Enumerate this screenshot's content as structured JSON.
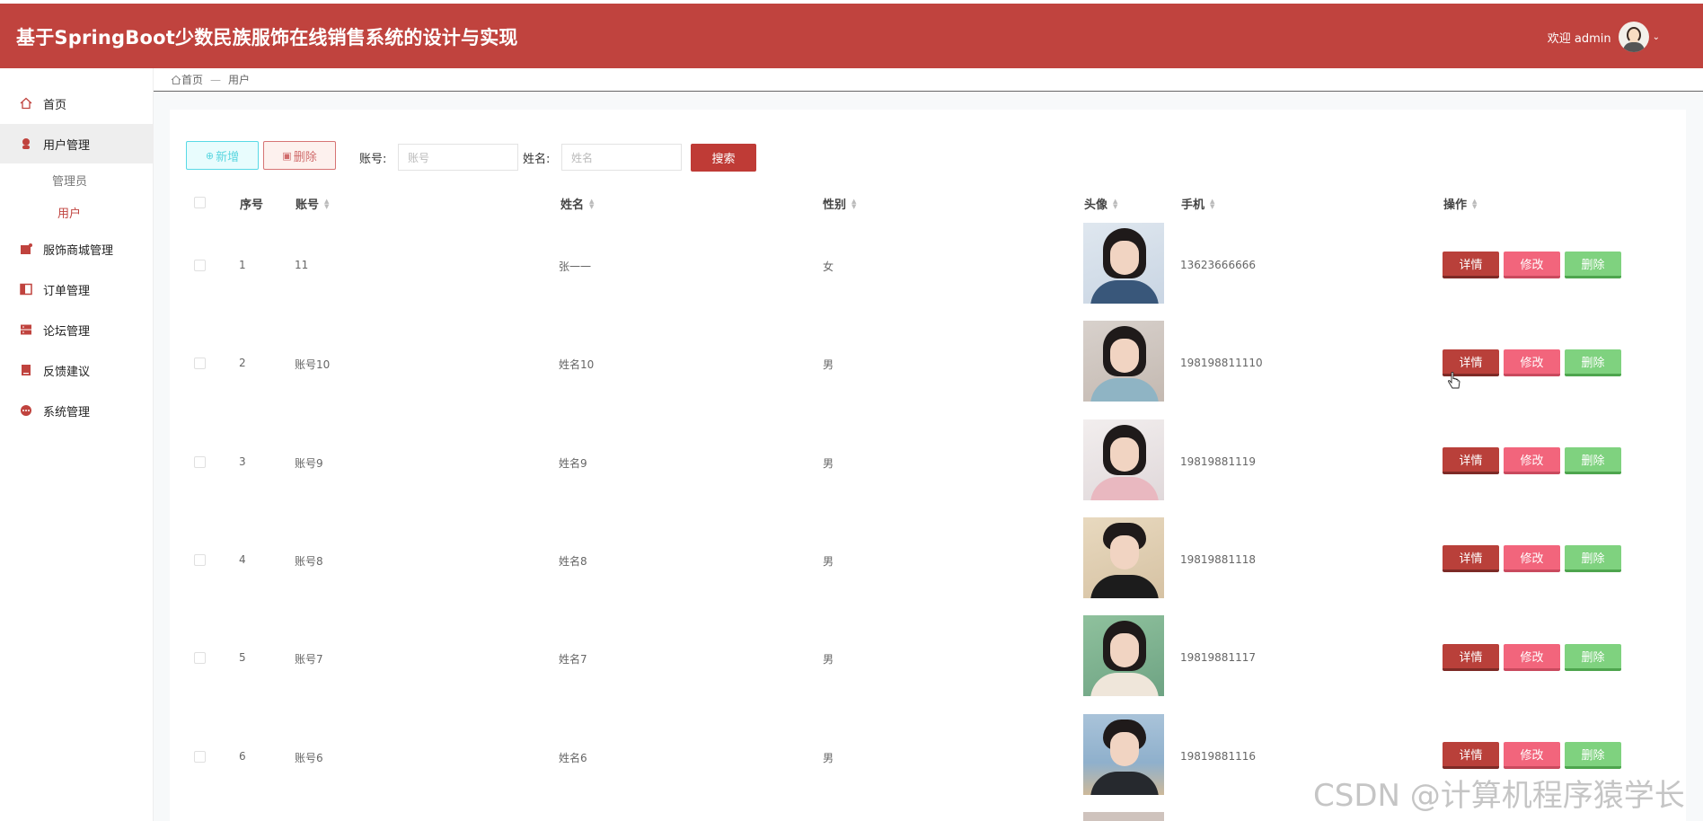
{
  "header": {
    "title": "基于SpringBoot少数民族服饰在线销售系统的设计与实现",
    "welcome": "欢迎 admin",
    "brand_color": "#c0433e"
  },
  "sidebar": {
    "items": [
      {
        "label": "首页",
        "icon": "home-icon"
      },
      {
        "label": "用户管理",
        "icon": "user-icon"
      },
      {
        "label": "服饰商城管理",
        "icon": "shop-icon"
      },
      {
        "label": "订单管理",
        "icon": "order-icon"
      },
      {
        "label": "论坛管理",
        "icon": "forum-icon"
      },
      {
        "label": "反馈建议",
        "icon": "feedback-icon"
      },
      {
        "label": "系统管理",
        "icon": "settings-icon"
      }
    ],
    "sub_items": [
      {
        "label": "管理员"
      },
      {
        "label": "用户"
      }
    ]
  },
  "breadcrumb": {
    "home": "首页",
    "sep": "—",
    "current": "用户"
  },
  "toolbar": {
    "add_label": "新增",
    "delete_label": "删除",
    "account_label": "账号:",
    "account_placeholder": "账号",
    "name_label": "姓名:",
    "name_placeholder": "姓名",
    "search_label": "搜索"
  },
  "table": {
    "headers": [
      "序号",
      "账号",
      "姓名",
      "性别",
      "头像",
      "手机",
      "操作"
    ],
    "actions": {
      "detail": "详情",
      "edit": "修改",
      "delete": "删除"
    },
    "rows": [
      {
        "index": "1",
        "account": "11",
        "name": "张一一",
        "gender": "女",
        "phone": "13623666666"
      },
      {
        "index": "2",
        "account": "账号10",
        "name": "姓名10",
        "gender": "男",
        "phone": "198198811110"
      },
      {
        "index": "3",
        "account": "账号9",
        "name": "姓名9",
        "gender": "男",
        "phone": "19819881119"
      },
      {
        "index": "4",
        "account": "账号8",
        "name": "姓名8",
        "gender": "男",
        "phone": "19819881118"
      },
      {
        "index": "5",
        "account": "账号7",
        "name": "姓名7",
        "gender": "男",
        "phone": "19819881117"
      },
      {
        "index": "6",
        "account": "账号6",
        "name": "姓名6",
        "gender": "男",
        "phone": "19819881116"
      }
    ]
  },
  "watermark": "CSDN @计算机程序猿学长"
}
